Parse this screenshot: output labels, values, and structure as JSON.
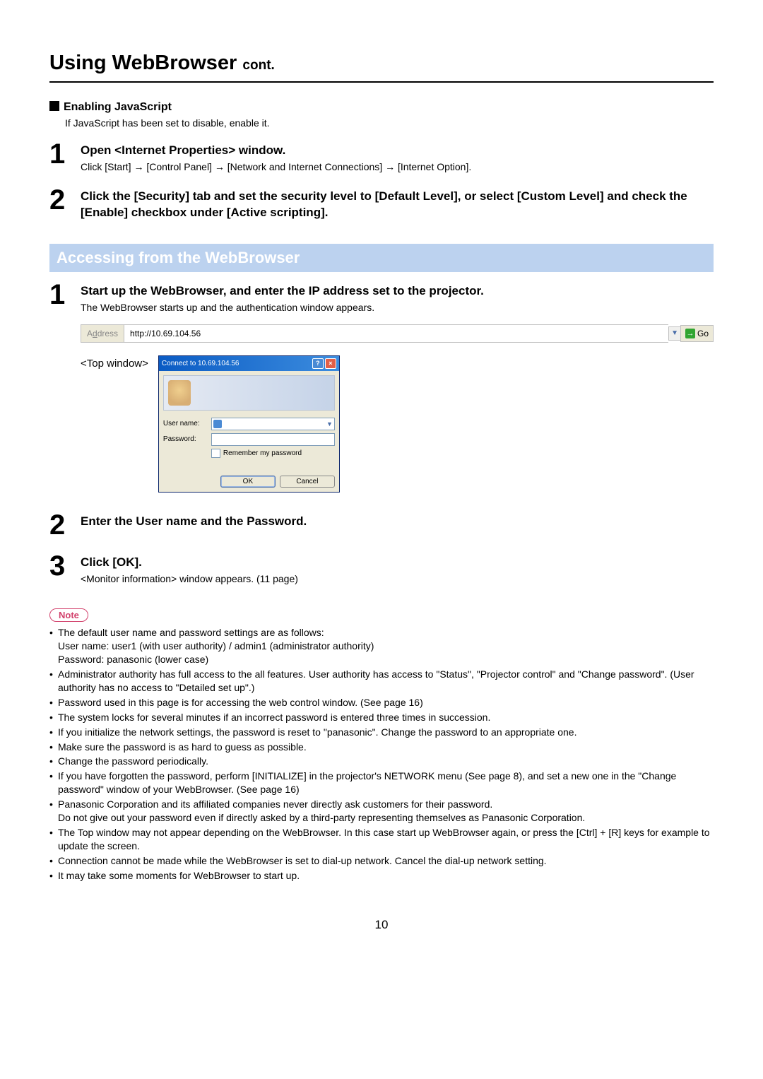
{
  "title_main": "Using WebBrowser",
  "title_cont": "cont.",
  "js_heading": "Enabling JavaScript",
  "js_desc": "If JavaScript has been set to disable, enable it.",
  "js_steps": [
    {
      "num": "1",
      "title": "Open <Internet Properties> window.",
      "desc": "Click [Start] → [Control Panel] → [Network and Internet Connections] → [Internet Option]."
    },
    {
      "num": "2",
      "title": "Click the [Security] tab and set the security level to [Default Level], or select [Custom Level] and check the [Enable] checkbox under [Active scripting].",
      "desc": ""
    }
  ],
  "section_heading": "Accessing from the WebBrowser",
  "acc_steps": [
    {
      "num": "1",
      "title": "Start up the WebBrowser, and enter the IP address set to the projector.",
      "desc": "The WebBrowser starts up and the authentication window appears."
    },
    {
      "num": "2",
      "title": "Enter the User name and the Password.",
      "desc": ""
    },
    {
      "num": "3",
      "title": "Click [OK].",
      "desc": "<Monitor information> window appears. (11 page)"
    }
  ],
  "addr": {
    "label_pre": "A",
    "label_underline": "d",
    "label_post": "dress",
    "value": "http://10.69.104.56",
    "go": "Go"
  },
  "dialog": {
    "top_label": "<Top window>",
    "title": "Connect to 10.69.104.56",
    "user_label": "User name:",
    "pass_label": "Password:",
    "remember": "Remember my password",
    "ok": "OK",
    "cancel": "Cancel"
  },
  "note_label": "Note",
  "notes": [
    "The default user name and password settings are as follows:\nUser name: user1 (with user authority) / admin1 (administrator authority)\nPassword: panasonic (lower case)",
    "Administrator authority has full access to the all features. User authority has access to \"Status\", \"Projector control\" and \"Change password\". (User authority has no access to \"Detailed set up\".)",
    "Password used in this page is for accessing the web control window. (See page 16)",
    "The system locks for several minutes if an incorrect password is entered three times in succession.",
    "If you initialize the network settings, the password is reset to \"panasonic\". Change the password to an appropriate one.",
    "Make sure the password is as hard to guess as possible.",
    "Change the password periodically.",
    "If you have forgotten the password, perform [INITIALIZE] in the projector's NETWORK menu (See page 8), and set a new one in the \"Change password\" window of your WebBrowser. (See page 16)",
    "Panasonic Corporation and its affiliated companies never directly ask customers for their password.\nDo not give out your password even if directly asked by a third-party representing themselves as Panasonic Corporation.",
    "The Top window may not appear depending on the WebBrowser. In this case start up WebBrowser again, or press the [Ctrl] + [R] keys for example to update the screen.",
    "Connection cannot be made while the WebBrowser is set to dial-up network. Cancel the dial-up network setting.",
    "It may take some moments for WebBrowser to start up."
  ],
  "page_number": "10"
}
